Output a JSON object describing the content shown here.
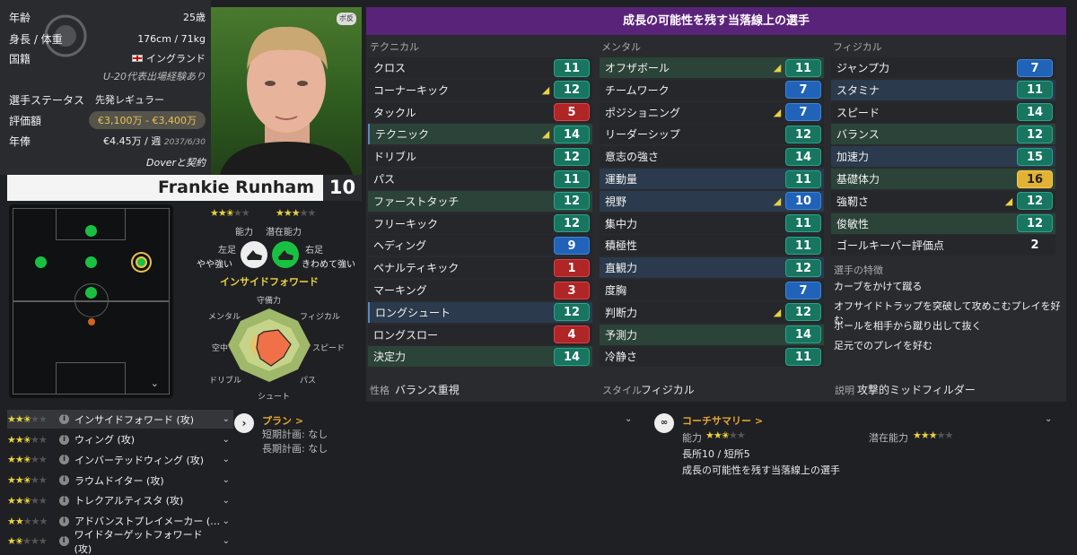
{
  "info": {
    "age_label": "年齢",
    "age": "25歳",
    "height_label": "身長 / 体重",
    "height": "176cm / 71kg",
    "nation_label": "国籍",
    "nation": "イングランド",
    "u20": "U-20代表出場経験あり",
    "status_label": "選手ステータス",
    "status": "先発レギュラー",
    "value_label": "評価額",
    "value": "€3,100万 - €3,400万",
    "wage_label": "年俸",
    "wage": "€4.45万 / 週",
    "wage_date": "2037/6/30",
    "contract": "Doverと契約"
  },
  "player": {
    "name": "Frankie Runham",
    "number": "10",
    "tag": "ボ反"
  },
  "ability": {
    "label": "能力",
    "potential_label": "潜在能力"
  },
  "feet": {
    "left_label": "左足",
    "left": "やや強い",
    "right_label": "右足",
    "right": "きわめて強い"
  },
  "role_title": "インサイドフォワード",
  "radar": {
    "top": "守備力",
    "tr": "フィジカル",
    "r": "スピード",
    "br": "パス",
    "b": "シュート",
    "bl": "ドリブル",
    "l": "空中",
    "tl": "メンタル"
  },
  "attr_header": "成長の可能性を残す当落線上の選手",
  "col_labels": {
    "technical": "テクニカル",
    "mental": "メンタル",
    "physical": "フィジカル"
  },
  "technical": [
    {
      "name": "クロス",
      "value": "11"
    },
    {
      "name": "コーナーキック",
      "value": "12"
    },
    {
      "name": "タックル",
      "value": "5"
    },
    {
      "name": "テクニック",
      "value": "14"
    },
    {
      "name": "ドリブル",
      "value": "12"
    },
    {
      "name": "パス",
      "value": "11"
    },
    {
      "name": "ファーストタッチ",
      "value": "12"
    },
    {
      "name": "フリーキック",
      "value": "12"
    },
    {
      "name": "ヘディング",
      "value": "9"
    },
    {
      "name": "ペナルティキック",
      "value": "1"
    },
    {
      "name": "マーキング",
      "value": "3"
    },
    {
      "name": "ロングシュート",
      "value": "12"
    },
    {
      "name": "ロングスロー",
      "value": "4"
    },
    {
      "name": "決定力",
      "value": "14"
    }
  ],
  "mental": [
    {
      "name": "オフザボール",
      "value": "11"
    },
    {
      "name": "チームワーク",
      "value": "7"
    },
    {
      "name": "ポジショニング",
      "value": "7"
    },
    {
      "name": "リーダーシップ",
      "value": "12"
    },
    {
      "name": "意志の強さ",
      "value": "14"
    },
    {
      "name": "運動量",
      "value": "11"
    },
    {
      "name": "視野",
      "value": "10"
    },
    {
      "name": "集中力",
      "value": "11"
    },
    {
      "name": "積極性",
      "value": "11"
    },
    {
      "name": "直観力",
      "value": "12"
    },
    {
      "name": "度胸",
      "value": "7"
    },
    {
      "name": "判断力",
      "value": "12"
    },
    {
      "name": "予測力",
      "value": "14"
    },
    {
      "name": "冷静さ",
      "value": "11"
    }
  ],
  "physical": [
    {
      "name": "ジャンプ力",
      "value": "7"
    },
    {
      "name": "スタミナ",
      "value": "11"
    },
    {
      "name": "スピード",
      "value": "14"
    },
    {
      "name": "バランス",
      "value": "12"
    },
    {
      "name": "加速力",
      "value": "15"
    },
    {
      "name": "基礎体力",
      "value": "16"
    },
    {
      "name": "強靭さ",
      "value": "12"
    },
    {
      "name": "俊敏性",
      "value": "12"
    },
    {
      "name": "ゴールキーパー評価点",
      "value": "2"
    }
  ],
  "traits_label": "選手の特徴",
  "traits": [
    "カーブをかけて蹴る",
    "オフサイドトラップを突破して攻めこむプレイを好む",
    "ボールを相手から蹴り出して抜く",
    "足元でのプレイを好む"
  ],
  "personality_label": "性格",
  "personality": "バランス重視",
  "style_label": "スタイル",
  "style": "フィジカル",
  "desc_label": "説明",
  "desc": "攻撃的ミッドフィルダー",
  "roles": [
    {
      "name": "インサイドフォワード (攻)",
      "stars": 2.5
    },
    {
      "name": "ウィング (攻)",
      "stars": 2.5
    },
    {
      "name": "インバーテッドウィング (攻)",
      "stars": 2.5
    },
    {
      "name": "ラウムドイター (攻)",
      "stars": 2.5
    },
    {
      "name": "トレクアルティスタ (攻)",
      "stars": 2.5
    },
    {
      "name": "アドバンストプレイメーカー (…",
      "stars": 2
    },
    {
      "name": "ワイドターゲットフォワード (攻)",
      "stars": 1.5
    }
  ],
  "plan": {
    "title": "プラン >",
    "short": "短期計画: なし",
    "long": "長期計画: なし"
  },
  "coach": {
    "title": "コーチサマリー >",
    "ability": "能力",
    "potential": "潜在能力",
    "line1": "長所10 / 短所5",
    "line2": "成長の可能性を残す当落線上の選手"
  }
}
